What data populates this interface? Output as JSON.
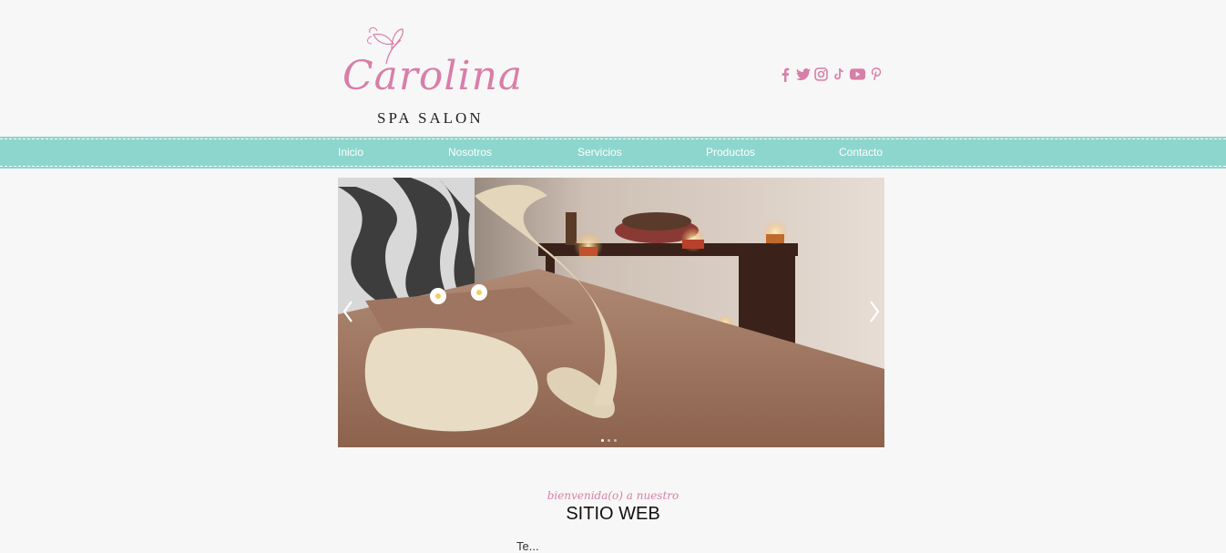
{
  "header": {
    "logo_script": "Carolina",
    "logo_sub": "SPA SALON"
  },
  "social": {
    "color": "#d77fa8",
    "icons": [
      "facebook-icon",
      "twitter-icon",
      "instagram-icon",
      "tiktok-icon",
      "youtube-icon",
      "pinterest-icon"
    ]
  },
  "nav": {
    "background": "#8dd6cd",
    "items": [
      "Inicio",
      "Nosotros",
      "Servicios",
      "Productos",
      "Contacto"
    ]
  },
  "slider": {
    "prev_icon": "chevron-left-icon",
    "next_icon": "chevron-right-icon",
    "slides": 3,
    "current": 1
  },
  "intro": {
    "welcome": "bienvenida(o) a nuestro",
    "title": "SITIO WEB",
    "body_start": "Te..."
  }
}
